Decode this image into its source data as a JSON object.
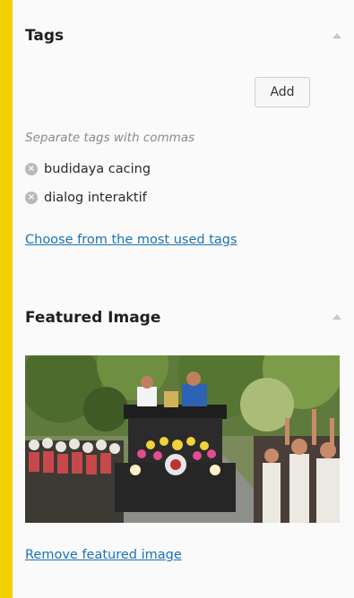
{
  "tags_box": {
    "title": "Tags",
    "input_value": "",
    "add_label": "Add",
    "howto": "Separate tags with commas",
    "tags": [
      "budidaya cacing",
      "dialog interaktif"
    ],
    "most_used_link": "Choose from the most used tags"
  },
  "featured_box": {
    "title": "Featured Image",
    "remove_link": "Remove featured image"
  },
  "colors": {
    "page_border": "#f2d000",
    "panel_bg": "#fafafa",
    "link": "#1a73b8"
  },
  "icons": {
    "collapse": "triangle-up-icon",
    "remove_tag": "x-circle-icon"
  }
}
